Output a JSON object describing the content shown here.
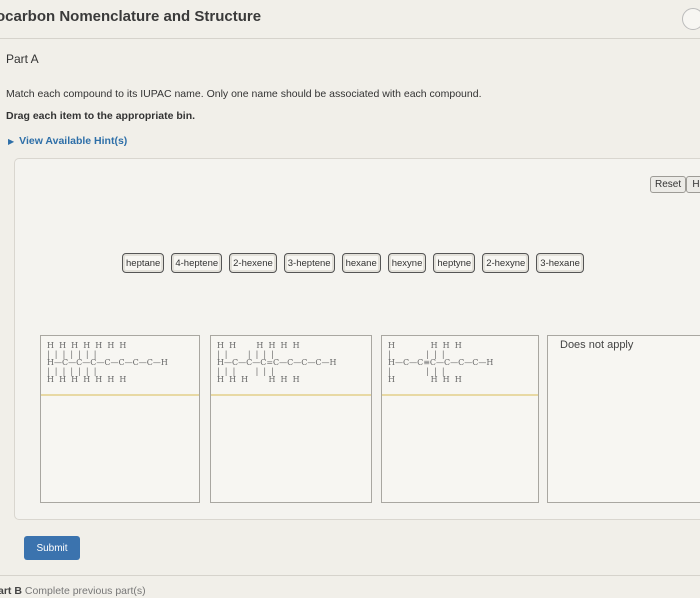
{
  "header": {
    "title": "ocarbon Nomenclature and Structure"
  },
  "part_a": {
    "label": "Part A",
    "instruction": "Match each compound to its IUPAC name. Only one name should be associated with each compound.",
    "drag_text": "Drag each item to the appropriate bin.",
    "hints_link": "View Available Hint(s)"
  },
  "toolbar": {
    "reset_label": "Reset",
    "help_label": "H"
  },
  "items": [
    "heptane",
    "4-heptene",
    "2-hexene",
    "3-heptene",
    "hexane",
    "hexyne",
    "heptyne",
    "2-hexyne",
    "3-hexane"
  ],
  "bins": [
    {
      "structure": "H  H  H  H  H  H  H\n|  |  |  |  |  |  |\nH—C—C—C—C—C—C—C—H\n|  |  |  |  |  |  |\nH  H  H  H  H  H  H"
    },
    {
      "structure": "H  H        H  H  H  H\n|  |        |  |  |  |\nH—C—C—C=C—C—C—C—H\n|  |  |        |  |  |\nH  H  H        H  H  H"
    },
    {
      "structure": "H              H  H  H\n|              |  |  |\nH—C—C≡C—C—C—C—H\n|              |  |  |\nH              H  H  H"
    },
    {
      "label": "Does not apply"
    }
  ],
  "submit_label": "Submit",
  "part_b": {
    "label": "art B",
    "text": "Complete previous part(s)"
  }
}
